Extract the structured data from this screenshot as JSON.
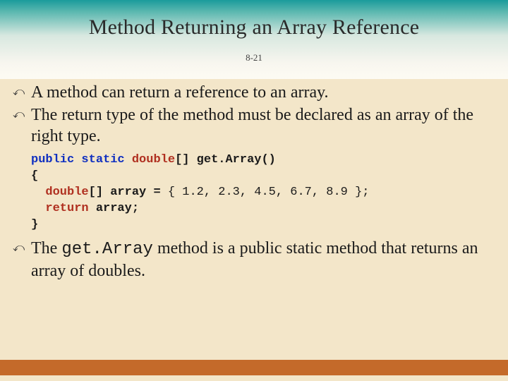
{
  "title": "Method Returning an Array Reference",
  "slide_number": "8-21",
  "bullets": {
    "b1": "A method can return a reference to an array.",
    "b2": "The return type of the method must be declared as an array of the right type.",
    "b3_pre": "The ",
    "b3_code": "get.Array",
    "b3_post": " method is a public static method that returns an array of doubles."
  },
  "code": {
    "kw_public": "public",
    "kw_static": "static",
    "kw_double1": "double",
    "decl_tail": "[] get.Array()",
    "brace_open": "{",
    "kw_double2": "double",
    "arr_decl": "[] array = ",
    "arr_vals": "{ 1.2, 2.3, 4.5, 6.7, 8.9 };",
    "kw_return": "return",
    "ret_tail": " array;",
    "brace_close": "}"
  }
}
